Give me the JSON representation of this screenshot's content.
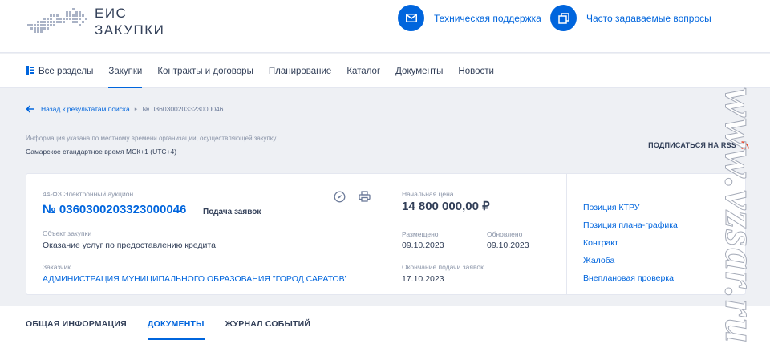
{
  "header": {
    "logo_line1": "ЕИС",
    "logo_line2": "ЗАКУПКИ",
    "support_label": "Техническая поддержка",
    "faq_label": "Часто задаваемые вопросы",
    "accent": "#0065dd"
  },
  "nav": {
    "items": [
      {
        "label": "Все разделы",
        "icon": "sections-icon"
      },
      {
        "label": "Закупки"
      },
      {
        "label": "Контракты и договоры"
      },
      {
        "label": "Планирование"
      },
      {
        "label": "Каталог"
      },
      {
        "label": "Документы"
      },
      {
        "label": "Новости"
      }
    ],
    "active_index": 1
  },
  "breadcrumb": {
    "back_label": "Назад к результатам поиска",
    "current": "№ 0360300203323000046"
  },
  "timezone": {
    "note": "Информация указана по местному времени организации, осуществляющей закупку",
    "value": "Самарское стандартное время МСК+1 (UTC+4)"
  },
  "rss": {
    "label": "ПОДПИСАТЬСЯ НА RSS"
  },
  "card": {
    "law": "44-ФЗ Электронный аукцион",
    "reg_number": "№ 0360300203323000046",
    "stage": "Подача заявок",
    "object_label": "Объект закупки",
    "object_value": "Оказание услуг по предоставлению кредита",
    "customer_label": "Заказчик",
    "customer_value": "АДМИНИСТРАЦИЯ МУНИЦИПАЛЬНОГО ОБРАЗОВАНИЯ \"ГОРОД САРАТОВ\"",
    "price_label": "Начальная цена",
    "price_value": "14 800 000,00 ₽",
    "published_label": "Размещено",
    "published_value": "09.10.2023",
    "updated_label": "Обновлено",
    "updated_value": "09.10.2023",
    "end_label": "Окончание подачи заявок",
    "end_value": "17.10.2023",
    "links": [
      "Позиция КТРУ",
      "Позиция плана-графика",
      "Контракт",
      "Жалоба",
      "Внеплановая проверка"
    ]
  },
  "tabs": {
    "items": [
      "ОБЩАЯ ИНФОРМАЦИЯ",
      "ДОКУМЕНТЫ",
      "ЖУРНАЛ СОБЫТИЙ"
    ],
    "active_index": 1
  },
  "watermark": "www.vzsar.ru"
}
